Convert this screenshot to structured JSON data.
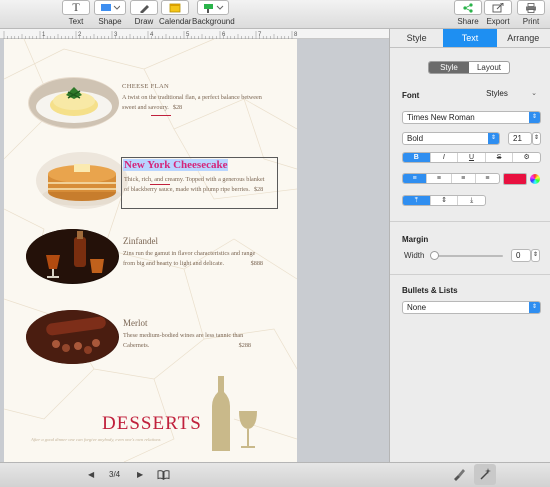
{
  "toolbar": {
    "items": [
      {
        "label": "Text",
        "icon": "T"
      },
      {
        "label": "Shape",
        "icon": "shape"
      },
      {
        "label": "Draw",
        "icon": "pencil"
      },
      {
        "label": "Calendar",
        "icon": "calendar"
      },
      {
        "label": "Background",
        "icon": "paint"
      },
      {
        "label": "Share",
        "icon": "share"
      },
      {
        "label": "Export",
        "icon": "export"
      },
      {
        "label": "Print",
        "icon": "printer"
      }
    ]
  },
  "ruler": {
    "numbers": [
      "1",
      "2",
      "3",
      "4",
      "5",
      "6",
      "7",
      "8"
    ]
  },
  "menu": {
    "items": [
      {
        "title": "CHEESE FLAN",
        "desc_line1": "A twist on the traditional flan, a perfect balance between",
        "desc_line2": "sweet and savoury.",
        "price": "$28"
      },
      {
        "title": "New York Cheesecake",
        "desc_line1": "Thick, rich, and creamy. Topped with a generous blanket",
        "desc_line2": "of blackberry sauce, made with plump ripe berries.",
        "price": "$28"
      },
      {
        "title": "Zinfandel",
        "desc_line1": "Zins run the gamut in flavor characteristics and range",
        "desc_line2": "from big and hearty to light and delicate.",
        "price": "$888"
      },
      {
        "title": "Merlot",
        "desc_line1": "These medium-bodied wines are less tannic than",
        "desc_line2": "Cabernets.",
        "price": "$288"
      }
    ],
    "heading": "DESSERTS",
    "tagline": "After a good dinner one can forgive anybody, even one's own relations"
  },
  "bottom": {
    "page_count": "3/4",
    "prev": "◀",
    "next": "▶"
  },
  "inspector": {
    "tabs": [
      "Style",
      "Text",
      "Arrange"
    ],
    "active_tab": "Text",
    "subtabs": [
      "Style",
      "Layout"
    ],
    "font_label": "Font",
    "styles_label": "Styles",
    "font_family": "Times New Roman",
    "font_weight": "Bold",
    "font_size": "21",
    "format_buttons": [
      "B",
      "I",
      "U",
      "S",
      "⚙"
    ],
    "align_buttons": [
      "≡",
      "≡",
      "≡",
      "≡"
    ],
    "text_color": "#e8103f",
    "valign_buttons": [
      "⤒",
      "⇕",
      "⤓"
    ],
    "margin_label": "Margin",
    "width_label": "Width",
    "width_value": "0",
    "bullets_label": "Bullets & Lists",
    "bullets_value": "None"
  },
  "colors": {
    "accent": "#1e8ff2",
    "desserts": "#c0203c",
    "highlight_title": "#d4267a"
  }
}
